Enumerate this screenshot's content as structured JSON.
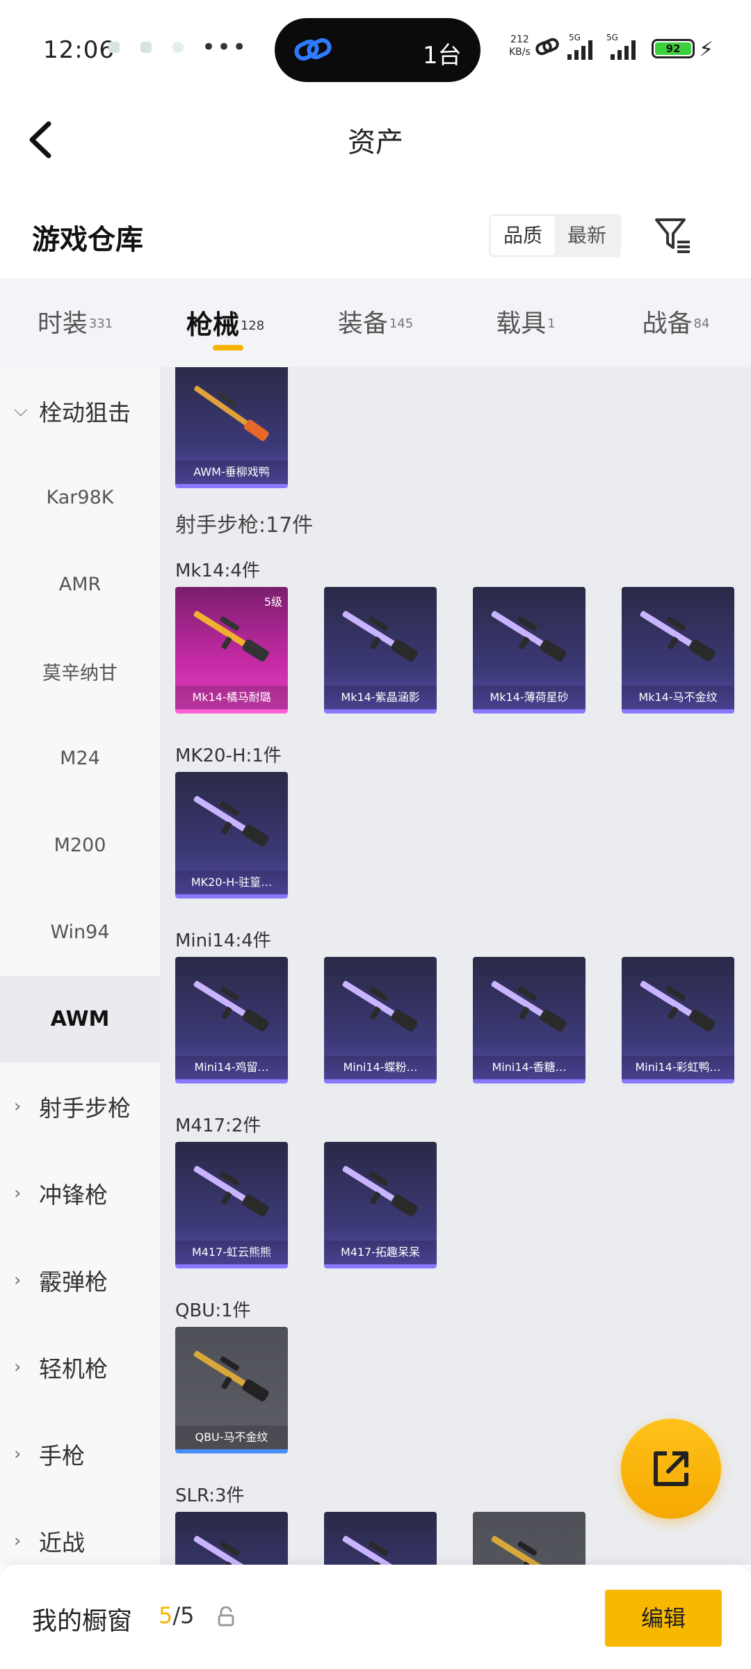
{
  "status_bar": {
    "time": "12:06",
    "island_count": "1台",
    "net_speed_value": "212",
    "net_speed_unit": "KB/s",
    "network_type_1": "5G",
    "network_type_2": "5G",
    "battery": "92"
  },
  "header": {
    "title": "资产"
  },
  "warehouse": {
    "title": "游戏仓库",
    "sort_options": [
      "品质",
      "最新"
    ],
    "sort_active": "品质"
  },
  "tabs": [
    {
      "label": "时装",
      "count": "331"
    },
    {
      "label": "枪械",
      "count": "128"
    },
    {
      "label": "装备",
      "count": "145"
    },
    {
      "label": "载具",
      "count": "1"
    },
    {
      "label": "战备",
      "count": "84"
    }
  ],
  "sidebar": {
    "groups": [
      {
        "label": "栓动狙击",
        "expanded": true,
        "children": [
          "Kar98K",
          "AMR",
          "莫辛纳甘",
          "M24",
          "M200",
          "Win94",
          "AWM"
        ]
      },
      {
        "label": "射手步枪"
      },
      {
        "label": "冲锋枪"
      },
      {
        "label": "霰弹枪"
      },
      {
        "label": "轻机枪"
      },
      {
        "label": "手枪"
      },
      {
        "label": "近战"
      }
    ],
    "active": "AWM"
  },
  "content": {
    "top_card": {
      "name": "AWM-垂柳戏鸭"
    },
    "category_total": "射手步枪:17件",
    "sections": [
      {
        "label": "Mk14:4件",
        "items": [
          {
            "name": "Mk14-橘马耐璐",
            "level": "5级",
            "style": "pink"
          },
          {
            "name": "Mk14-紫晶涵影",
            "style": "purple"
          },
          {
            "name": "Mk14-薄荷星砂",
            "style": "purple"
          },
          {
            "name": "Mk14-马不金纹",
            "style": "purple"
          }
        ]
      },
      {
        "label": "MK20-H:1件",
        "items": [
          {
            "name": "MK20-H-驻篁…",
            "style": "purple"
          }
        ]
      },
      {
        "label": "Mini14:4件",
        "items": [
          {
            "name": "Mini14-鸡留…",
            "style": "purple"
          },
          {
            "name": "Mini14-蝶粉…",
            "style": "purple"
          },
          {
            "name": "Mini14-香糖…",
            "style": "purple"
          },
          {
            "name": "Mini14-彩虹鸭…",
            "style": "purple"
          }
        ]
      },
      {
        "label": "M417:2件",
        "items": [
          {
            "name": "M417-虹云熊熊",
            "style": "purple"
          },
          {
            "name": "M417-拓趣呆呆",
            "style": "purple"
          }
        ]
      },
      {
        "label": "QBU:1件",
        "items": [
          {
            "name": "QBU-马不金纹",
            "style": "grey"
          }
        ]
      },
      {
        "label": "SLR:3件",
        "items": [
          {
            "name": "",
            "style": "purple"
          },
          {
            "name": "",
            "style": "purple"
          },
          {
            "name": "",
            "style": "grey"
          }
        ]
      }
    ]
  },
  "bottom_bar": {
    "title": "我的橱窗",
    "count_current": "5",
    "count_total": "/5",
    "edit_label": "编辑"
  },
  "colors": {
    "accent": "#f5b300",
    "purple_card": "#3c3a78",
    "pink_card": "#c42aa4",
    "grey_card": "#5d5e66"
  }
}
